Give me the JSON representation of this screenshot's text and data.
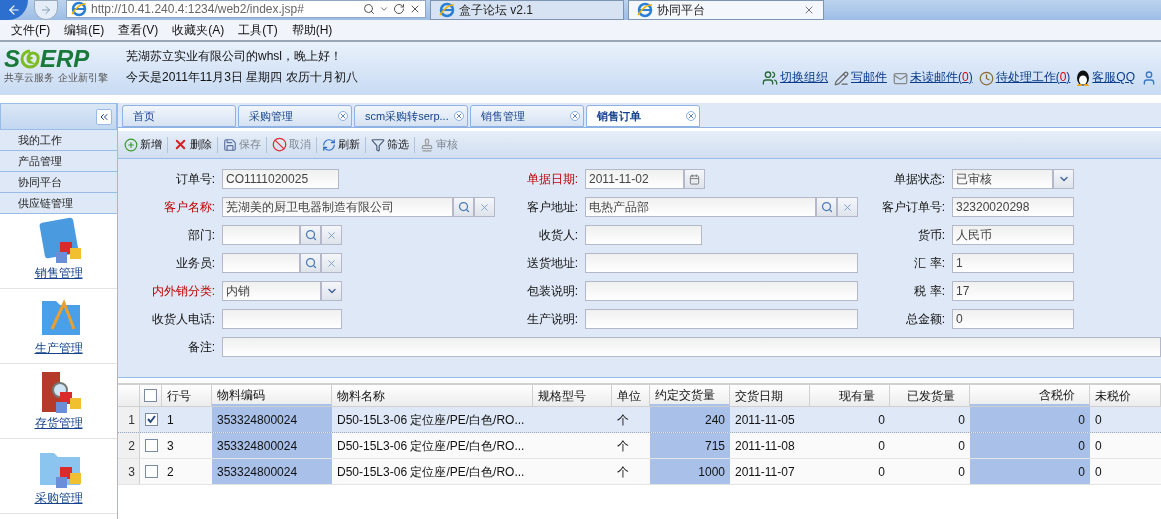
{
  "browser": {
    "address": "http://10.41.240.4:1234/web2/index.jsp#",
    "tabs": [
      {
        "title": "盒子论坛 v2.1",
        "selected": false
      },
      {
        "title": "协同平台",
        "selected": true
      }
    ],
    "menu": [
      "文件(F)",
      "编辑(E)",
      "查看(V)",
      "收藏夹(A)",
      "工具(T)",
      "帮助(H)"
    ]
  },
  "header": {
    "logo": {
      "left": "S",
      "right": "ERP",
      "tagline": [
        "共享云服务",
        "企业新引擎"
      ]
    },
    "greeting": "芜湖苏立实业有限公司的whsl，晚上好！",
    "date_line": "今天是2011年11月3日 星期四 农历十月初八",
    "links": [
      {
        "label": "切换组织"
      },
      {
        "label": "写邮件"
      },
      {
        "label": "未读邮件(",
        "count": "0",
        "suffix": ")"
      },
      {
        "label": "待处理工作(",
        "count": "0",
        "suffix": ")"
      },
      {
        "label": "客服QQ"
      }
    ]
  },
  "sidebar": {
    "items": [
      "我的工作",
      "产品管理",
      "协同平台",
      "供应链管理"
    ],
    "modules": [
      "销售管理",
      "生产管理",
      "存货管理",
      "采购管理"
    ]
  },
  "tabs": [
    {
      "label": "首页",
      "closable": false,
      "selected": false
    },
    {
      "label": "采购管理",
      "closable": true,
      "selected": false
    },
    {
      "label": "scm采购转serp...",
      "closable": true,
      "selected": false
    },
    {
      "label": "销售管理",
      "closable": true,
      "selected": false
    },
    {
      "label": "销售订单",
      "closable": true,
      "selected": true
    }
  ],
  "toolbar": [
    {
      "label": "新增",
      "disabled": false
    },
    {
      "label": "删除",
      "disabled": false
    },
    {
      "label": "保存",
      "disabled": true
    },
    {
      "label": "取消",
      "disabled": true
    },
    {
      "label": "刷新",
      "disabled": false
    },
    {
      "label": "筛选",
      "disabled": false
    },
    {
      "label": "审核",
      "disabled": true
    }
  ],
  "form": {
    "rows": [
      [
        {
          "label": "订单号:",
          "required": false,
          "kind": "text",
          "value": "CO1111020025"
        },
        {
          "label": "单据日期:",
          "required": true,
          "kind": "date",
          "value": "2011-11-02"
        },
        {
          "label": "单据状态:",
          "required": false,
          "kind": "select",
          "value": "已审核"
        }
      ],
      [
        {
          "label": "客户名称:",
          "required": true,
          "kind": "lookup",
          "value": "芜湖美的厨卫电器制造有限公司"
        },
        {
          "label": "客户地址:",
          "required": false,
          "kind": "lookup",
          "value": "电热产品部"
        },
        {
          "label": "客户订单号:",
          "required": false,
          "kind": "text",
          "value": "32320020298"
        }
      ],
      [
        {
          "label": "部门:",
          "required": false,
          "kind": "lookup"
        },
        {
          "label": "收货人:",
          "required": false,
          "kind": "text"
        },
        {
          "label": "货币:",
          "required": false,
          "kind": "text",
          "value": "人民币"
        }
      ],
      [
        {
          "label": "业务员:",
          "required": false,
          "kind": "lookup"
        },
        {
          "label": "送货地址:",
          "required": false,
          "kind": "text"
        },
        {
          "label": "汇 率:",
          "required": false,
          "kind": "text",
          "value": "1"
        }
      ],
      [
        {
          "label": "内外销分类:",
          "required": true,
          "kind": "select",
          "value": "内销"
        },
        {
          "label": "包装说明:",
          "required": false,
          "kind": "text"
        },
        {
          "label": "税 率:",
          "required": false,
          "kind": "text",
          "value": "17"
        }
      ],
      [
        {
          "label": "收货人电话:",
          "required": false,
          "kind": "text"
        },
        {
          "label": "生产说明:",
          "required": false,
          "kind": "text"
        },
        {
          "label": "总金额:",
          "required": false,
          "kind": "text",
          "value": "0"
        }
      ],
      [
        {
          "label": "备注:",
          "required": false,
          "kind": "text"
        }
      ]
    ]
  },
  "table": {
    "all_checked": false,
    "columns": [
      {
        "label": "行号",
        "editable": false
      },
      {
        "label": "物料编码",
        "editable": true
      },
      {
        "label": "物料名称",
        "editable": false
      },
      {
        "label": "规格型号",
        "editable": false
      },
      {
        "label": "单位",
        "editable": false
      },
      {
        "label": "约定交货量",
        "editable": true
      },
      {
        "label": "交货日期",
        "editable": false
      },
      {
        "label": "现有量",
        "editable": false
      },
      {
        "label": "已发货量",
        "editable": false
      },
      {
        "label": "含税价",
        "editable": true
      },
      {
        "label": "未税价",
        "editable": false
      }
    ],
    "rows": [
      {
        "number": "1",
        "checked": true,
        "selected": true,
        "cells": [
          "1",
          "353324800024",
          "D50-15L3-06 定位座/PE/白色/RO...",
          null,
          "个",
          "240",
          "2011-11-05",
          "0",
          "0",
          "0",
          "0"
        ]
      },
      {
        "number": "2",
        "checked": false,
        "selected": false,
        "cells": [
          "3",
          "353324800024",
          "D50-15L3-06 定位座/PE/白色/RO...",
          null,
          "个",
          "715",
          "2011-11-08",
          "0",
          "0",
          "0",
          "0"
        ]
      },
      {
        "number": "3",
        "checked": false,
        "selected": false,
        "cells": [
          "2",
          "353324800024",
          "D50-15L3-06 定位座/PE/白色/RO...",
          null,
          "个",
          "1000",
          "2011-11-07",
          "0",
          "0",
          "0",
          "0"
        ]
      }
    ]
  }
}
